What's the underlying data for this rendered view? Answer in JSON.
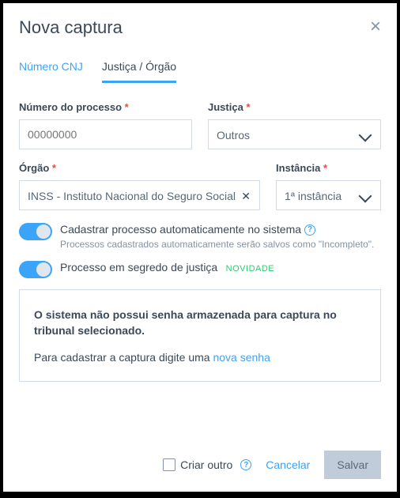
{
  "header": {
    "title": "Nova captura"
  },
  "tabs": {
    "cnj": "Número CNJ",
    "justica": "Justiça / Órgão"
  },
  "fields": {
    "processo": {
      "label": "Número do processo",
      "placeholder": "00000000"
    },
    "justica": {
      "label": "Justiça",
      "value": "Outros"
    },
    "orgao": {
      "label": "Órgão",
      "value": "INSS - Instituto Nacional do Seguro Social"
    },
    "instancia": {
      "label": "Instância",
      "value": "1ª instância"
    }
  },
  "required_mark": "*",
  "toggles": {
    "auto": {
      "label": "Cadastrar processo automaticamente no sistema",
      "sub": "Processos cadastrados automaticamente serão salvos como \"Incompleto\"."
    },
    "segredo": {
      "label": "Processo em segredo de justiça",
      "badge": "NOVIDADE"
    }
  },
  "info": {
    "title": "O sistema não possui senha armazenada para captura no tribunal selecionado.",
    "text": "Para cadastrar a captura digite uma ",
    "link": "nova senha"
  },
  "footer": {
    "criar_outro": "Criar outro",
    "cancelar": "Cancelar",
    "salvar": "Salvar"
  },
  "help_char": "?"
}
